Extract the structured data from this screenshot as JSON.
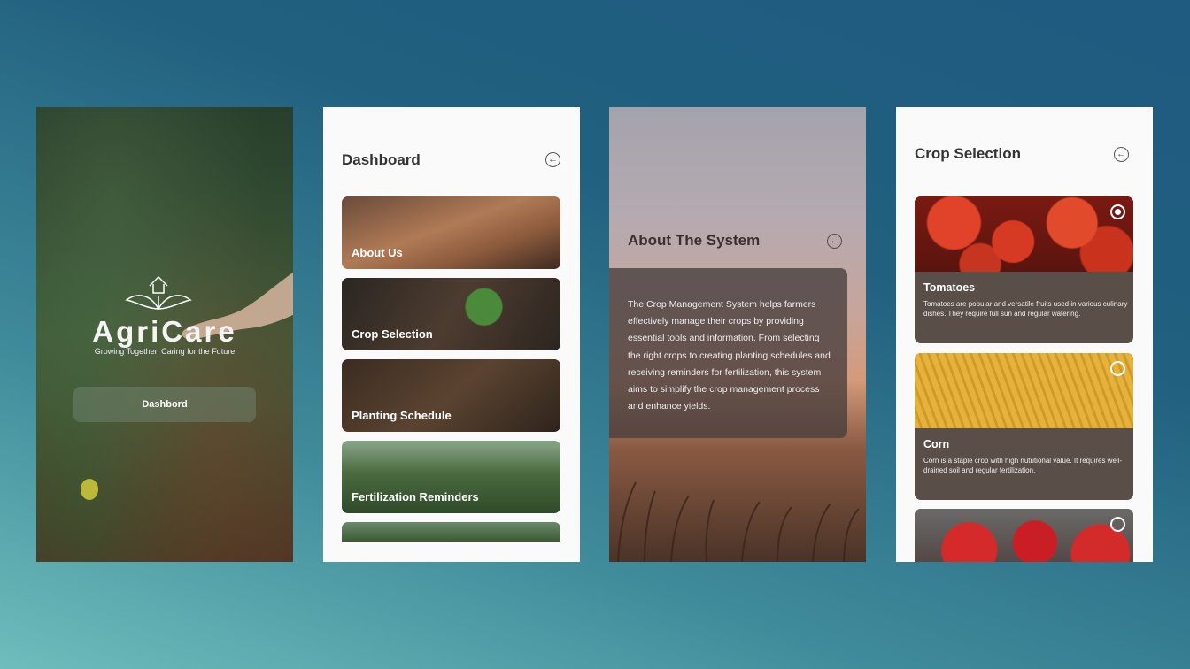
{
  "splash": {
    "brand": "AgriCare",
    "tagline": "Growing Together, Caring for the Future",
    "button_label": "Dashbord"
  },
  "dashboard": {
    "title": "Dashboard",
    "items": [
      {
        "label": "About Us"
      },
      {
        "label": "Crop Selection"
      },
      {
        "label": "Planting Schedule"
      },
      {
        "label": "Fertilization Reminders"
      }
    ]
  },
  "about": {
    "title": "About The System",
    "body": "The Crop Management System helps farmers effectively manage their crops by providing essential tools and information. From selecting the right crops to creating planting schedules and receiving reminders for fertilization, this system aims to simplify the crop management process and enhance yields."
  },
  "crop_selection": {
    "title": "Crop Selection",
    "crops": [
      {
        "name": "Tomatoes",
        "description": "Tomatoes are popular and versatile fruits used in various culinary dishes. They require full sun and regular watering.",
        "selected": true
      },
      {
        "name": "Corn",
        "description": "Corn is a staple crop with high nutritional value. It requires well-drained soil and regular fertilization.",
        "selected": false
      },
      {
        "name": "",
        "description": "",
        "selected": false
      }
    ]
  },
  "colors": {
    "background_dark": "#1f5a80",
    "background_light": "#6fbdbc",
    "card_brown": "#5a4e48"
  }
}
